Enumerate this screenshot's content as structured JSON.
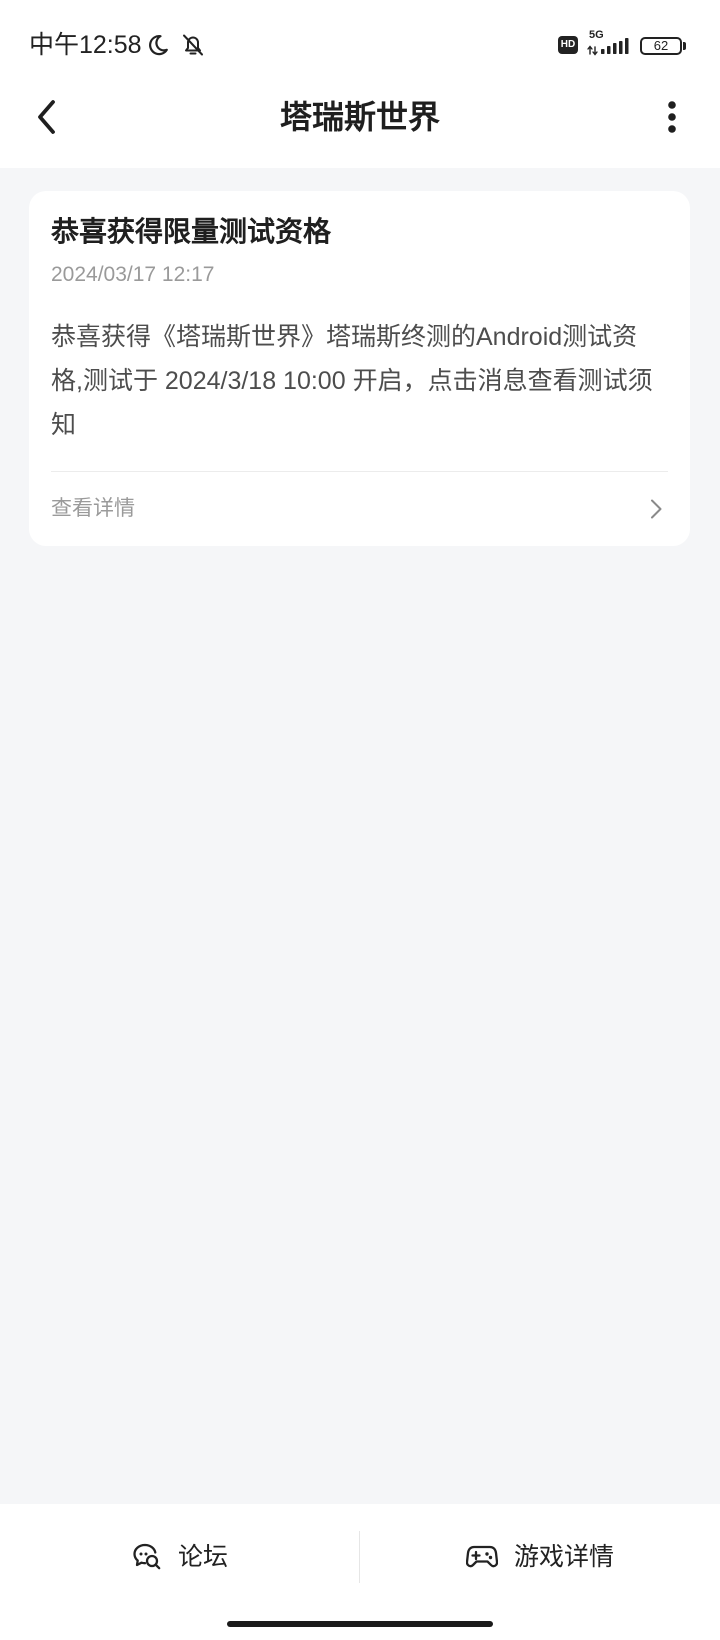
{
  "status_bar": {
    "time": "中午12:58",
    "hd_badge": "HD",
    "network_type": "5G",
    "battery_level": "62",
    "icons": [
      "moon-icon",
      "bell-off-icon",
      "signal-icon",
      "battery-icon"
    ]
  },
  "header": {
    "title": "塔瑞斯世界",
    "icons": {
      "back": "back-arrow-icon",
      "more": "more-vertical-icon"
    }
  },
  "message_card": {
    "title": "恭喜获得限量测试资格",
    "date": "2024/03/17 12:17",
    "body": "恭喜获得《塔瑞斯世界》塔瑞斯终测的Android测试资格,测试于 2024/3/18 10:00 开启，点击消息查看测试须知",
    "details_link": "查看详情",
    "icons": {
      "details": "chevron-right-icon"
    }
  },
  "bottom_bar": {
    "forum_label": "论坛",
    "game_details_label": "游戏详情",
    "icons": {
      "forum": "forum-chat-icon",
      "game_details": "gamepad-icon"
    }
  },
  "colors": {
    "background": "#f5f6f8",
    "card": "#ffffff",
    "text_primary": "#222222",
    "text_secondary": "#9a9a9a",
    "text_body": "#4d4d4d",
    "divider": "#ececec"
  }
}
